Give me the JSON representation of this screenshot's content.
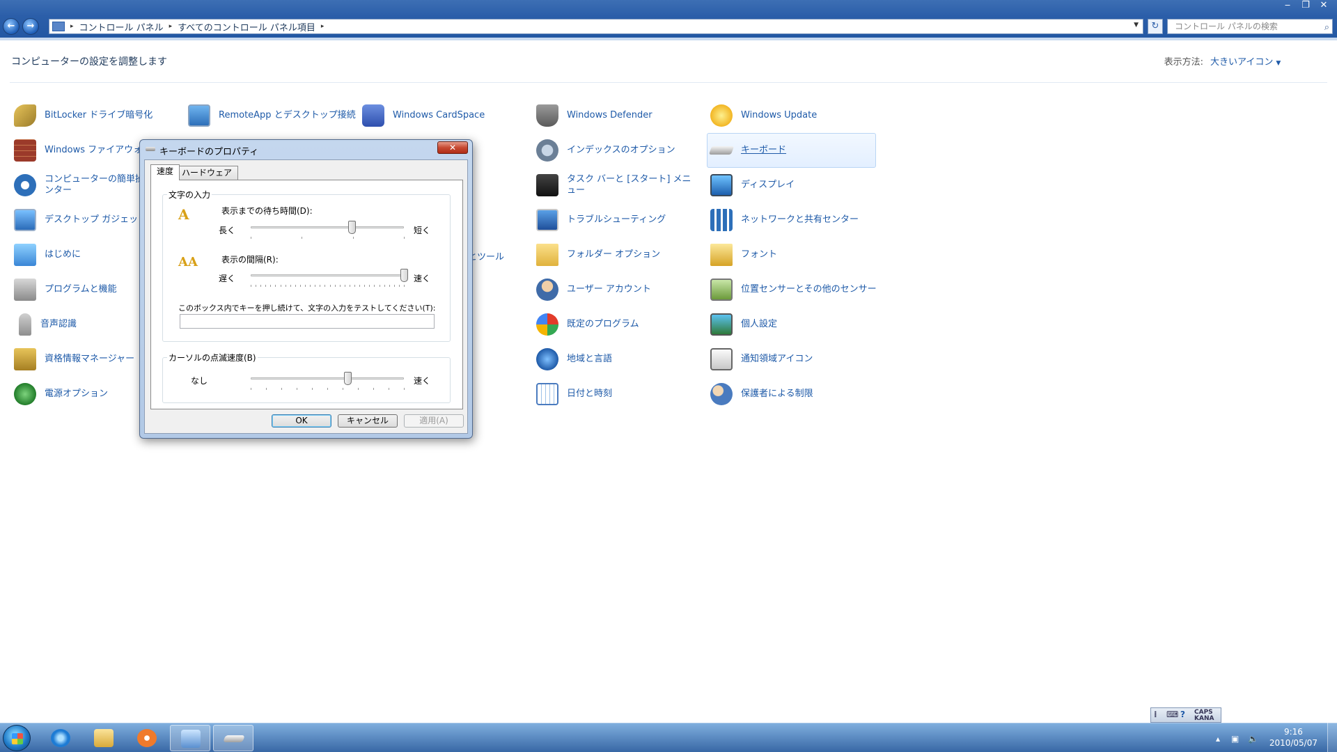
{
  "window": {
    "minimize": "‒",
    "restore": "❐",
    "close": "✕",
    "back": "←",
    "forward": "→",
    "breadcrumb": [
      "コントロール パネル",
      "すべてのコントロール パネル項目"
    ],
    "search_placeholder": "コントロール パネルの検索"
  },
  "header": {
    "title": "コンピューターの設定を調整します",
    "view_by_label": "表示方法:",
    "view_by_value": "大きいアイコン"
  },
  "items": [
    {
      "label": "BitLocker ドライブ暗号化",
      "icon": "bitlocker-icon"
    },
    {
      "label": "RemoteApp とデスクトップ接続",
      "icon": "remoteapp-icon"
    },
    {
      "label": "Windows CardSpace",
      "icon": "cardspace-icon"
    },
    {
      "label": "Windows Defender",
      "icon": "defender-icon"
    },
    {
      "label": "Windows Update",
      "icon": "windows-update-icon"
    },
    {
      "label": "Windows ファイアウォ",
      "icon": "firewall-icon"
    },
    {
      "label": "インデックスのオプション",
      "icon": "indexing-icon"
    },
    {
      "label": "キーボード",
      "icon": "keyboard-icon",
      "selected": true
    },
    {
      "label": "コンピューターの簡単操作センター",
      "icon": "ease-of-access-icon"
    },
    {
      "label": "タスク バーと [スタート] メニュー",
      "icon": "taskbar-icon"
    },
    {
      "label": "ディスプレイ",
      "icon": "display-icon"
    },
    {
      "label": "デスクトップ ガジェット",
      "icon": "gadgets-icon"
    },
    {
      "label": "トラブルシューティング",
      "icon": "troubleshooting-icon"
    },
    {
      "label": "ネットワークと共有センター",
      "icon": "network-icon"
    },
    {
      "label": "はじめに",
      "icon": "getting-started-icon"
    },
    {
      "label": "とツール",
      "icon": "partial-item-icon"
    },
    {
      "label": "フォルダー オプション",
      "icon": "folder-options-icon"
    },
    {
      "label": "フォント",
      "icon": "fonts-icon"
    },
    {
      "label": "プログラムと機能",
      "icon": "programs-icon"
    },
    {
      "label": "ユーザー アカウント",
      "icon": "user-accounts-icon"
    },
    {
      "label": "位置センサーとその他のセンサー",
      "icon": "sensors-icon"
    },
    {
      "label": "音声認識",
      "icon": "speech-icon"
    },
    {
      "label": "既定のプログラム",
      "icon": "default-programs-icon"
    },
    {
      "label": "個人設定",
      "icon": "personalization-icon"
    },
    {
      "label": "資格情報マネージャー",
      "icon": "credential-icon"
    },
    {
      "label": "地域と言語",
      "icon": "region-icon"
    },
    {
      "label": "通知領域アイコン",
      "icon": "notification-icon"
    },
    {
      "label": "電源オプション",
      "icon": "power-icon"
    },
    {
      "label": "日付と時刻",
      "icon": "date-time-icon"
    },
    {
      "label": "保護者による制限",
      "icon": "parental-icon"
    }
  ],
  "dialog": {
    "title": "キーボードのプロパティ",
    "close": "✕",
    "tabs": [
      "速度",
      "ハードウェア"
    ],
    "group_input": "文字の入力",
    "repeat_delay_label": "表示までの待ち時間(D):",
    "repeat_delay_left": "長く",
    "repeat_delay_right": "短く",
    "repeat_delay_value": 0.66,
    "repeat_rate_label": "表示の間隔(R):",
    "repeat_rate_left": "遅く",
    "repeat_rate_right": "速く",
    "repeat_rate_value": 1.0,
    "test_label": "このボックス内でキーを押し続けて、文字の入力をテストしてください(T):",
    "group_cursor": "カーソルの点滅速度(B)",
    "cursor_left": "なし",
    "cursor_right": "速く",
    "cursor_value": 0.63,
    "ok": "OK",
    "cancel": "キャンセル",
    "apply": "適用(A)"
  },
  "taskbar": {
    "time": "9:16",
    "date": "2010/05/07",
    "ime_caps": "CAPS",
    "ime_kana": "KANA"
  }
}
